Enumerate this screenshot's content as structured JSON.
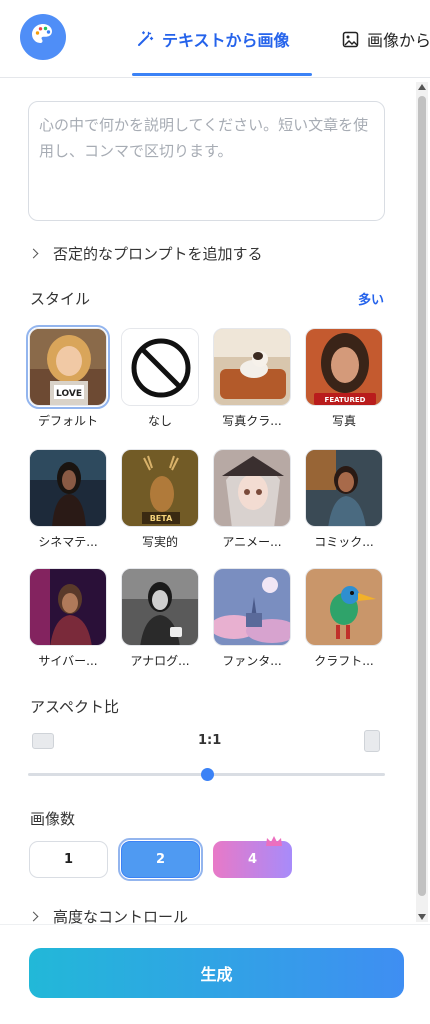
{
  "header": {
    "tabs": [
      {
        "label": "テキストから画像",
        "icon": "magic-wand-icon",
        "active": true
      },
      {
        "label": "画像から",
        "icon": "image-icon",
        "active": false
      }
    ],
    "accent": "#2563eb"
  },
  "prompt": {
    "placeholder": "心の中で何かを説明してください。短い文章を使用し、コンマで区切ります。",
    "value": ""
  },
  "negative_prompt": {
    "label": "否定的なプロンプトを追加する"
  },
  "style": {
    "label": "スタイル",
    "more": "多い",
    "items": [
      {
        "name": "デフォルト",
        "selected": true
      },
      {
        "name": "なし",
        "selected": false
      },
      {
        "name": "写真クラ...",
        "selected": false
      },
      {
        "name": "写真",
        "selected": false,
        "badge": "FEATURED"
      },
      {
        "name": "シネマテ...",
        "selected": false
      },
      {
        "name": "写実的",
        "selected": false,
        "badge": "BETA"
      },
      {
        "name": "アニメー...",
        "selected": false
      },
      {
        "name": "コミック...",
        "selected": false
      },
      {
        "name": "サイバー...",
        "selected": false
      },
      {
        "name": "アナログ...",
        "selected": false
      },
      {
        "name": "ファンタ...",
        "selected": false
      },
      {
        "name": "クラフト...",
        "selected": false
      }
    ],
    "thumb_texts": {
      "love_sign": "LOVE"
    }
  },
  "aspect": {
    "label": "アスペクト比",
    "value": "1:1",
    "slider_level": 0.5
  },
  "count": {
    "label": "画像数",
    "options": [
      {
        "label": "1",
        "selected": false
      },
      {
        "label": "2",
        "selected": true
      },
      {
        "label": "4",
        "selected": false,
        "premium": true
      }
    ]
  },
  "advanced": {
    "label": "高度なコントロール"
  },
  "generate": {
    "label": "生成"
  }
}
